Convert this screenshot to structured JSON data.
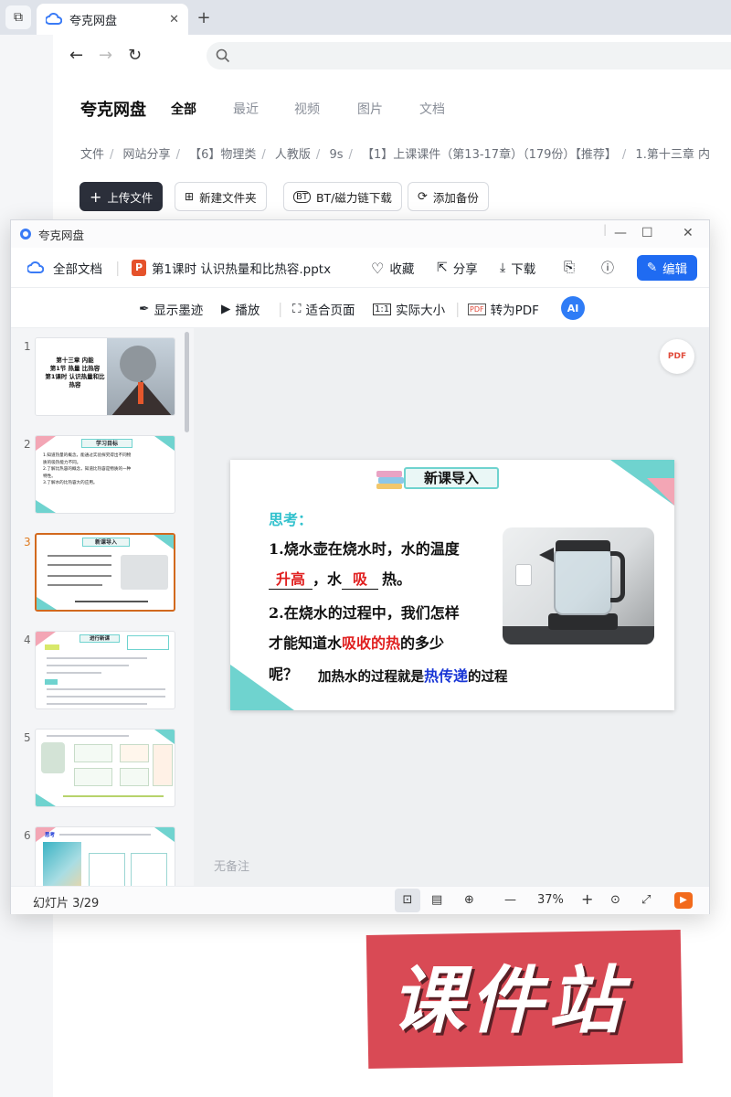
{
  "browser": {
    "tab_title": "夸克网盘"
  },
  "site": {
    "brand": "夸克网盘",
    "nav": [
      "全部",
      "最近",
      "视频",
      "图片",
      "文档"
    ],
    "breadcrumb": [
      "文件",
      "网站分享",
      "【6】物理类",
      "人教版",
      "9s",
      "【1】上课课件（第13-17章）（179份）【推荐】",
      "1.第十三章 内"
    ],
    "buttons": {
      "upload": "上传文件",
      "new_folder": "新建文件夹",
      "bt_download": "BT/磁力链下载",
      "add_backup": "添加备份"
    }
  },
  "viewer": {
    "window_title": "夸克网盘",
    "all_docs": "全部文档",
    "file_name": "第1课时 认识热量和比热容.pptx",
    "header_actions": {
      "favorite": "收藏",
      "share": "分享",
      "download": "下载",
      "edit": "编辑"
    },
    "toolbar": {
      "show_ink": "显示墨迹",
      "play": "播放",
      "fit_page": "适合页面",
      "actual_size": "实际大小",
      "to_pdf": "转为PDF",
      "ai_label": "AI"
    },
    "thumbnails": {
      "numbers": [
        "1",
        "2",
        "3",
        "4",
        "5",
        "6"
      ],
      "t1_lines": [
        "第十三章 内能",
        "第1节 热量 比热容",
        "第1课时 认识热量和比",
        "热容"
      ],
      "t2_title": "学习目标",
      "t2_lines": [
        "1.知道热量的概念，能通过实验探究得出不同物",
        "质的吸热能力不同。",
        "2.了解比热容的概念，知道比热容是物质的一种",
        "特性。",
        "3.了解水的比热容大的应用。"
      ],
      "t3_title": "新课导入",
      "t4_title": "进行新课",
      "t6_title": "思考"
    },
    "slide": {
      "title": "新课导入",
      "think": "思考：",
      "q1_line1": "1.烧水壶在烧水时，水的温度",
      "blank1": "升高",
      "q1_mid": "，水",
      "blank2": "吸",
      "q1_end": "热。",
      "q2_line1": "2.在烧水的过程中，我们怎样",
      "q2_line2a": "才能知道水",
      "q2_line2b": "吸收的热",
      "q2_line2c": "的多少",
      "q2_line3": "呢？",
      "conclusion_a": "加热水的过程就是",
      "conclusion_b": "热传递",
      "conclusion_c": "的过程"
    },
    "notes": "无备注",
    "status": {
      "slide_info": "幻灯片 3/29",
      "zoom": "37%"
    }
  },
  "watermark": "课件站",
  "colors": {
    "accent_blue": "#1f6bf2",
    "upload_dark": "#2b2f3a",
    "slide_teal": "#6fd3cf",
    "slide_pink": "#f3a6b5",
    "highlight_red": "#e02020",
    "highlight_blue": "#1a37d6",
    "stamp_red": "#d94a55"
  }
}
